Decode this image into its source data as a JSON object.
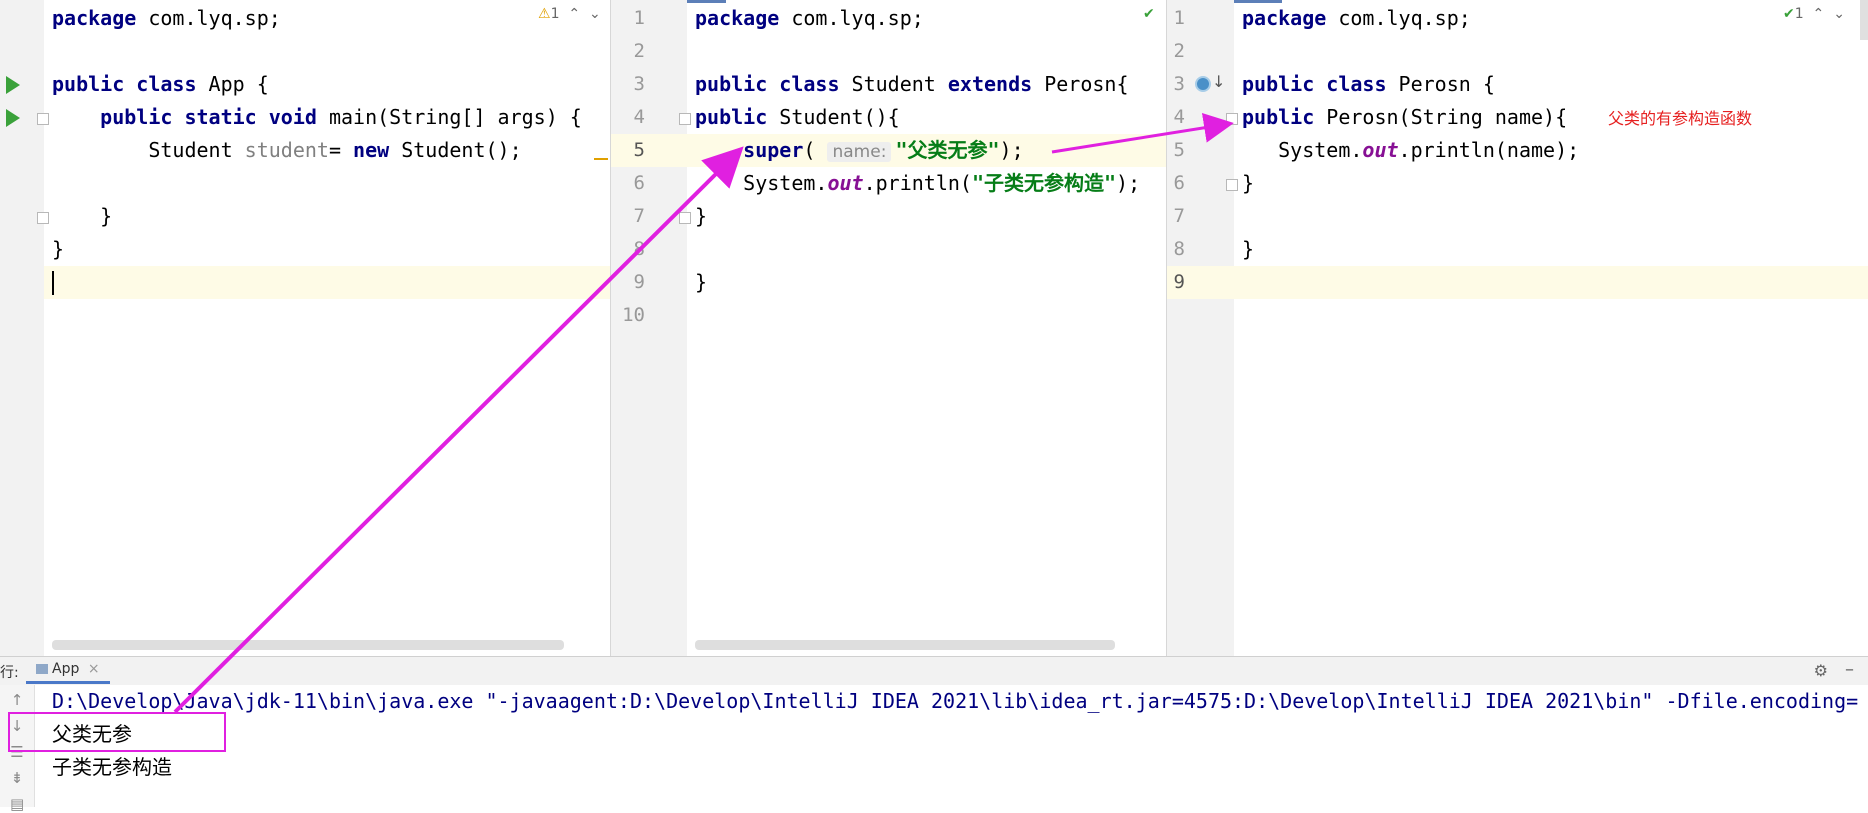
{
  "pane1": {
    "inspection": "1",
    "lines": [
      "package com.lyq.sp;",
      "",
      "public class App {",
      "    public static void main(String[] args) {",
      "        Student student= new Student();",
      "",
      "    }",
      "}",
      ""
    ]
  },
  "pane2": {
    "line_numbers": [
      "1",
      "2",
      "3",
      "4",
      "5",
      "6",
      "7",
      "8",
      "9",
      "10"
    ],
    "hint": "name:",
    "lines": [
      "package com.lyq.sp;",
      "",
      "public class Student extends Perosn{",
      "public Student(){",
      "    super(\"父类无参\");",
      "    System.out.println(\"子类无参构造\");",
      "}",
      "",
      "}",
      ""
    ]
  },
  "pane3": {
    "inspection": "1",
    "line_numbers": [
      "1",
      "2",
      "3",
      "4",
      "5",
      "6",
      "7",
      "8",
      "9"
    ],
    "lines": [
      "package com.lyq.sp;",
      "",
      "public class Perosn {",
      "public Perosn(String name){",
      "    System.out.println(name);",
      "}",
      "",
      "}",
      ""
    ],
    "annotation": "父类的有参构造函数"
  },
  "run": {
    "prefix": "行:",
    "tab_label": "App",
    "tab_close": "×",
    "console": [
      "D:\\Develop\\Java\\jdk-11\\bin\\java.exe \"-javaagent:D:\\Develop\\IntelliJ IDEA 2021\\lib\\idea_rt.jar=4575:D:\\Develop\\IntelliJ IDEA 2021\\bin\" -Dfile.encoding=",
      "父类无参",
      "子类无参构造"
    ]
  },
  "colors": {
    "keyword": "#000080",
    "string": "#067d17",
    "field": "#871094",
    "annotation_arrow": "#e020e0",
    "annotation_text": "#e62020"
  }
}
